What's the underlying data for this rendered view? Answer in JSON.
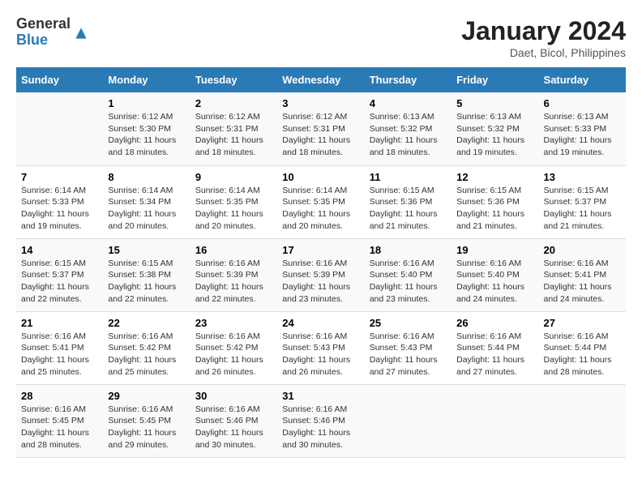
{
  "logo": {
    "line1": "General",
    "line2": "Blue"
  },
  "title": "January 2024",
  "subtitle": "Daet, Bicol, Philippines",
  "days_of_week": [
    "Sunday",
    "Monday",
    "Tuesday",
    "Wednesday",
    "Thursday",
    "Friday",
    "Saturday"
  ],
  "weeks": [
    [
      {
        "day": "",
        "info": ""
      },
      {
        "day": "1",
        "info": "Sunrise: 6:12 AM\nSunset: 5:30 PM\nDaylight: 11 hours and 18 minutes."
      },
      {
        "day": "2",
        "info": "Sunrise: 6:12 AM\nSunset: 5:31 PM\nDaylight: 11 hours and 18 minutes."
      },
      {
        "day": "3",
        "info": "Sunrise: 6:12 AM\nSunset: 5:31 PM\nDaylight: 11 hours and 18 minutes."
      },
      {
        "day": "4",
        "info": "Sunrise: 6:13 AM\nSunset: 5:32 PM\nDaylight: 11 hours and 18 minutes."
      },
      {
        "day": "5",
        "info": "Sunrise: 6:13 AM\nSunset: 5:32 PM\nDaylight: 11 hours and 19 minutes."
      },
      {
        "day": "6",
        "info": "Sunrise: 6:13 AM\nSunset: 5:33 PM\nDaylight: 11 hours and 19 minutes."
      }
    ],
    [
      {
        "day": "7",
        "info": "Sunrise: 6:14 AM\nSunset: 5:33 PM\nDaylight: 11 hours and 19 minutes."
      },
      {
        "day": "8",
        "info": "Sunrise: 6:14 AM\nSunset: 5:34 PM\nDaylight: 11 hours and 20 minutes."
      },
      {
        "day": "9",
        "info": "Sunrise: 6:14 AM\nSunset: 5:35 PM\nDaylight: 11 hours and 20 minutes."
      },
      {
        "day": "10",
        "info": "Sunrise: 6:14 AM\nSunset: 5:35 PM\nDaylight: 11 hours and 20 minutes."
      },
      {
        "day": "11",
        "info": "Sunrise: 6:15 AM\nSunset: 5:36 PM\nDaylight: 11 hours and 21 minutes."
      },
      {
        "day": "12",
        "info": "Sunrise: 6:15 AM\nSunset: 5:36 PM\nDaylight: 11 hours and 21 minutes."
      },
      {
        "day": "13",
        "info": "Sunrise: 6:15 AM\nSunset: 5:37 PM\nDaylight: 11 hours and 21 minutes."
      }
    ],
    [
      {
        "day": "14",
        "info": "Sunrise: 6:15 AM\nSunset: 5:37 PM\nDaylight: 11 hours and 22 minutes."
      },
      {
        "day": "15",
        "info": "Sunrise: 6:15 AM\nSunset: 5:38 PM\nDaylight: 11 hours and 22 minutes."
      },
      {
        "day": "16",
        "info": "Sunrise: 6:16 AM\nSunset: 5:39 PM\nDaylight: 11 hours and 22 minutes."
      },
      {
        "day": "17",
        "info": "Sunrise: 6:16 AM\nSunset: 5:39 PM\nDaylight: 11 hours and 23 minutes."
      },
      {
        "day": "18",
        "info": "Sunrise: 6:16 AM\nSunset: 5:40 PM\nDaylight: 11 hours and 23 minutes."
      },
      {
        "day": "19",
        "info": "Sunrise: 6:16 AM\nSunset: 5:40 PM\nDaylight: 11 hours and 24 minutes."
      },
      {
        "day": "20",
        "info": "Sunrise: 6:16 AM\nSunset: 5:41 PM\nDaylight: 11 hours and 24 minutes."
      }
    ],
    [
      {
        "day": "21",
        "info": "Sunrise: 6:16 AM\nSunset: 5:41 PM\nDaylight: 11 hours and 25 minutes."
      },
      {
        "day": "22",
        "info": "Sunrise: 6:16 AM\nSunset: 5:42 PM\nDaylight: 11 hours and 25 minutes."
      },
      {
        "day": "23",
        "info": "Sunrise: 6:16 AM\nSunset: 5:42 PM\nDaylight: 11 hours and 26 minutes."
      },
      {
        "day": "24",
        "info": "Sunrise: 6:16 AM\nSunset: 5:43 PM\nDaylight: 11 hours and 26 minutes."
      },
      {
        "day": "25",
        "info": "Sunrise: 6:16 AM\nSunset: 5:43 PM\nDaylight: 11 hours and 27 minutes."
      },
      {
        "day": "26",
        "info": "Sunrise: 6:16 AM\nSunset: 5:44 PM\nDaylight: 11 hours and 27 minutes."
      },
      {
        "day": "27",
        "info": "Sunrise: 6:16 AM\nSunset: 5:44 PM\nDaylight: 11 hours and 28 minutes."
      }
    ],
    [
      {
        "day": "28",
        "info": "Sunrise: 6:16 AM\nSunset: 5:45 PM\nDaylight: 11 hours and 28 minutes."
      },
      {
        "day": "29",
        "info": "Sunrise: 6:16 AM\nSunset: 5:45 PM\nDaylight: 11 hours and 29 minutes."
      },
      {
        "day": "30",
        "info": "Sunrise: 6:16 AM\nSunset: 5:46 PM\nDaylight: 11 hours and 30 minutes."
      },
      {
        "day": "31",
        "info": "Sunrise: 6:16 AM\nSunset: 5:46 PM\nDaylight: 11 hours and 30 minutes."
      },
      {
        "day": "",
        "info": ""
      },
      {
        "day": "",
        "info": ""
      },
      {
        "day": "",
        "info": ""
      }
    ]
  ]
}
